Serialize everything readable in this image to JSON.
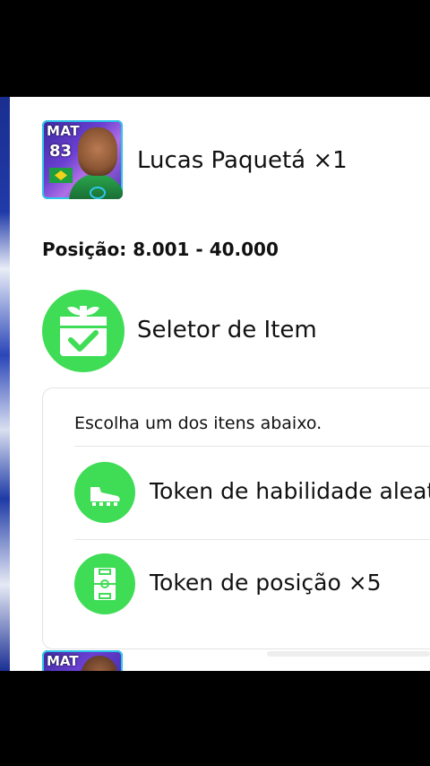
{
  "reward": {
    "card": {
      "position": "MAT",
      "rating": "83"
    },
    "name": "Lucas Paquetá ×1"
  },
  "position_range": "Posição: 8.001 - 40.000",
  "item_selector": {
    "label": "Seletor de Item",
    "hint": "Escolha um dos itens abaixo.",
    "options": [
      {
        "label": "Token de habilidade aleat",
        "icon": "boot-icon"
      },
      {
        "label": "Token de posição ×5",
        "icon": "pitch-icon"
      }
    ]
  },
  "next_reward": {
    "card": {
      "position": "MAT"
    }
  },
  "colors": {
    "accent_green": "#3fdc55",
    "card_purple": "#6a3fd1",
    "card_border": "#2ec6e8"
  }
}
